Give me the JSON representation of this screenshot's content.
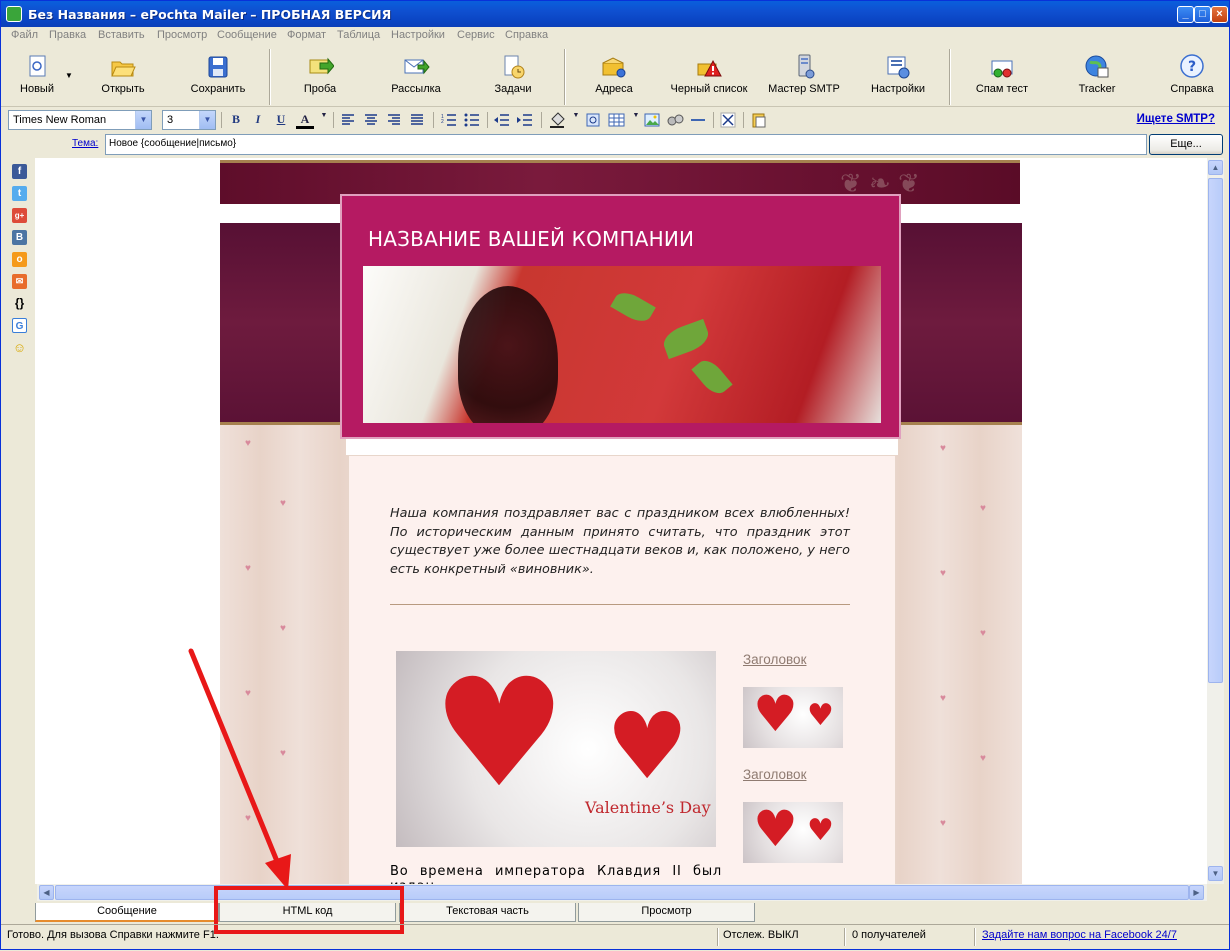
{
  "window": {
    "title": "Без Названия – ePochta Mailer – ПРОБНАЯ ВЕРСИЯ",
    "minimize": "_",
    "maximize": "□",
    "close": "×"
  },
  "menu": [
    "Файл",
    "Правка",
    "Вставить",
    "Просмотр",
    "Сообщение",
    "Формат",
    "Таблица",
    "Настройки",
    "Сервис",
    "Справка"
  ],
  "toolbar": {
    "new": "Новый",
    "open": "Открыть",
    "save": "Сохранить",
    "test": "Проба",
    "send": "Рассылка",
    "tasks": "Задачи",
    "addresses": "Адреса",
    "blacklist": "Черный список",
    "smtp_wizard": "Мастер SMTP",
    "settings": "Настройки",
    "spam_test": "Спам тест",
    "tracker": "Tracker",
    "help": "Справка"
  },
  "format": {
    "font": "Times New Roman",
    "size": "3",
    "bold": "B",
    "italic": "I",
    "underline": "U",
    "font_color": "A",
    "smtp_link": "Ищете SMTP?"
  },
  "subject": {
    "label": "Тема:",
    "value": "Новое {сообщение|письмо}",
    "more": "Еще..."
  },
  "email": {
    "company": "НАЗВАНИЕ ВАШЕЙ КОМПАНИИ",
    "intro": "Наша компания поздравляет вас с праздником всех влюбленных! По историческим данным принято считать, что праздник этот существует уже более шестнадцати веков и, как положено, у него есть конкретный «виновник».",
    "heading1": "Заголовок",
    "heading2": "Заголовок",
    "valentine": "Valentine’s Day",
    "bottom_text": "Во времена императора Клавдия II был издан"
  },
  "tabs": [
    "Сообщение",
    "HTML код",
    "Текстовая часть",
    "Просмотр"
  ],
  "status": {
    "ready": "Готово. Для вызова Справки нажмите F1.",
    "tracking": "Отслеж. ВЫКЛ",
    "recipients": "0 получателей",
    "facebook": "Задайте нам вопрос на Facebook 24/7"
  },
  "colors": {
    "highlight": "#e81818",
    "title_bar": "#0a5fdc",
    "template_maroon": "#6e1b3e"
  }
}
